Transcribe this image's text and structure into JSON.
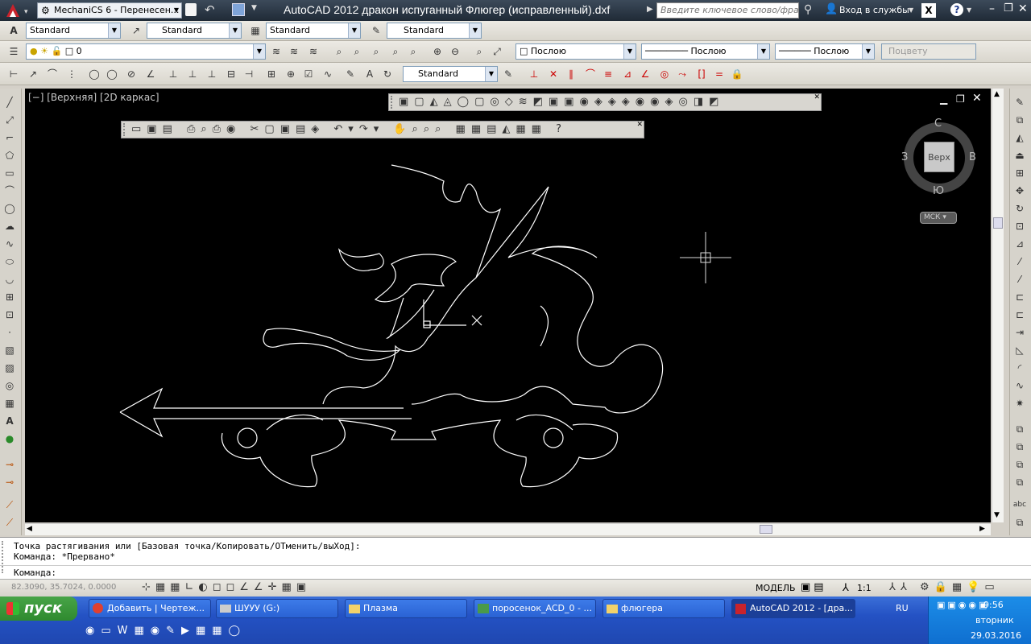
{
  "titlebar": {
    "workspace": "MechaniCS 6 - Перенесен...",
    "title": "AutoCAD 2012    дракон испуганный Флюгер (исправленный).dxf",
    "search_placeholder": "Введите ключевое слово/фразу",
    "signin": "Вход в службы"
  },
  "styles_toolbar": {
    "text_style": "Standard",
    "dim_style": "Standard",
    "table_style": "Standard",
    "mleader_style": "Standard"
  },
  "layers_toolbar": {
    "layer": "0",
    "color": "Послою",
    "linetype": "Послою",
    "lineweight": "Послою",
    "plotstyle": "Поцвету"
  },
  "dim_toolbar": {
    "dim_style": "Standard"
  },
  "viewport": {
    "label": "[−] [Верхняя] [2D каркас]",
    "background": "#000000",
    "drawing_color": "#ffffff"
  },
  "viewcube": {
    "face": "Верх",
    "north": "С",
    "south": "Ю",
    "west": "З",
    "east": "В",
    "ucs": "МСК"
  },
  "command": {
    "history": [
      "Точка растягивания или [Базовая точка/Копировать/ОТменить/выХод]:",
      "Команда: *Прервано*"
    ],
    "prompt": "Команда:"
  },
  "status": {
    "coords": "82.3090, 35.7024, 0.0000",
    "model": "МОДЕЛЬ",
    "scale": "1:1"
  },
  "taskbar": {
    "start": "пуск",
    "tasks": [
      "Добавить | Чертеж...",
      "ШУУУ (G:)",
      "Плазма",
      "поросенок_ACD_0 - ...",
      "флюгера",
      "AutoCAD 2012 - [дра..."
    ],
    "lang": "RU",
    "time": "9:56",
    "day": "вторник",
    "date": "29.03.2016"
  }
}
